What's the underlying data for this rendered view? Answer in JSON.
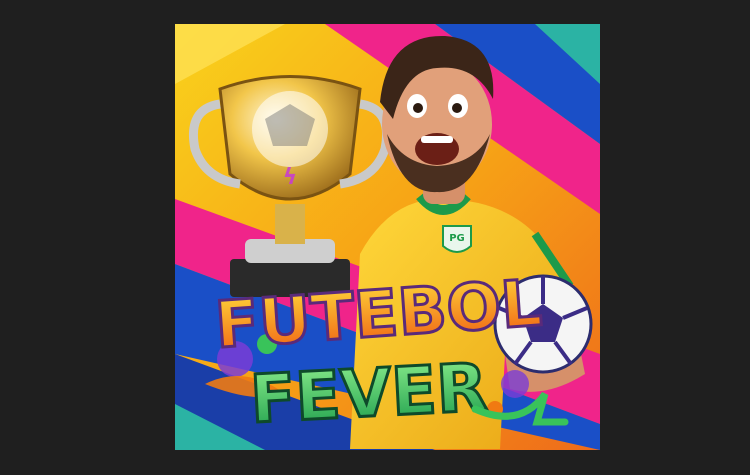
{
  "game": {
    "title_line1": "FUTEBOL",
    "title_line2": "FEVER",
    "badge_text": "PG"
  },
  "colors": {
    "page_background": "#1f1f1f",
    "background_yellow": "#f7b718",
    "stripe_pink": "#f0248a",
    "stripe_blue": "#1a4fc7",
    "stripe_teal": "#2bb3a4",
    "jersey_yellow": "#f4c21d",
    "jersey_green": "#1d9a4a",
    "title_orange": "#f07a12",
    "title_green": "#39c35a"
  },
  "icons": {
    "trophy": "trophy-icon",
    "ball": "soccer-ball-icon",
    "badge": "pg-badge-icon"
  }
}
